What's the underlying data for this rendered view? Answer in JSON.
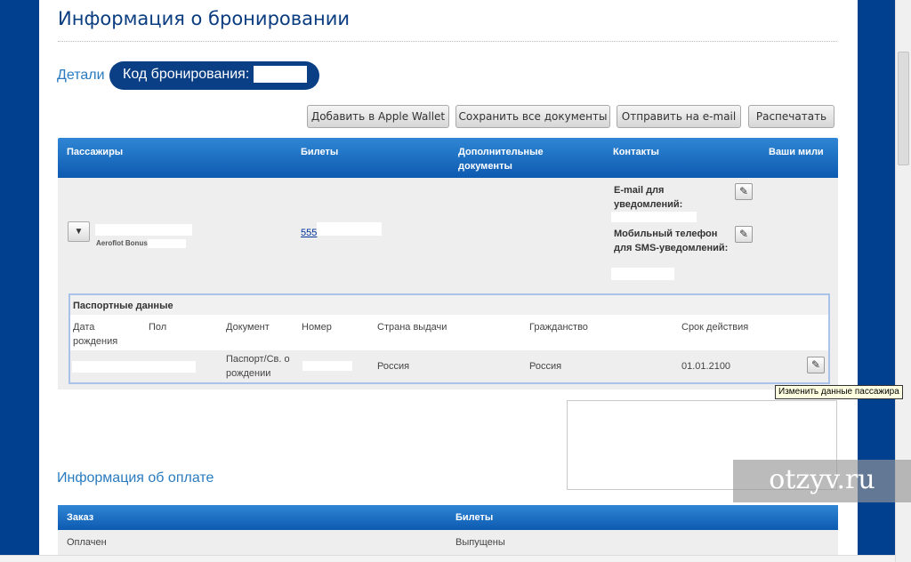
{
  "page": {
    "title": "Информация о бронировании",
    "details_label": "Детали",
    "booking_code_label": "Код бронирования:"
  },
  "actions": {
    "apple_wallet": "Добавить в Apple Wallet",
    "save_all": "Сохранить все документы",
    "send_email": "Отправить на e-mail",
    "print": "Распечатать"
  },
  "passengers_table": {
    "headers": {
      "passengers": "Пассажиры",
      "tickets": "Билеты",
      "extra_docs": "Дополнительные документы",
      "contacts": "Контакты",
      "miles": "Ваши мили"
    },
    "row": {
      "expand_icon": "▼",
      "bonus_program": "Aeroflot Bonus",
      "ticket_prefix": "555",
      "email_label": "E-mail для уведомлений:",
      "phone_label": "Мобильный телефон для SMS-уведомлений:"
    }
  },
  "passport": {
    "title": "Паспортные данные",
    "headers": {
      "birth_date": "Дата рождения",
      "gender": "Пол",
      "document": "Документ",
      "number": "Номер",
      "issue_country": "Страна выдачи",
      "citizenship": "Гражданство",
      "expiry": "Срок действия"
    },
    "row": {
      "document": "Паспорт/Св. о рождении",
      "issue_country": "Россия",
      "citizenship": "Россия",
      "expiry": "01.01.2100"
    }
  },
  "tooltip": "Изменить данные пассажира",
  "watermark": "otzyv.ru",
  "payment": {
    "title": "Информация об оплате",
    "headers": {
      "order": "Заказ",
      "tickets": "Билеты"
    },
    "row": {
      "order": "Оплачен",
      "tickets": "Выпущены"
    }
  },
  "icons": {
    "pencil": "✎"
  },
  "colors": {
    "brand_blue": "#01408f",
    "header_gradient_top": "#2f86d4",
    "header_gradient_bottom": "#0d5ab1",
    "link_blue": "#2a7bbf"
  }
}
